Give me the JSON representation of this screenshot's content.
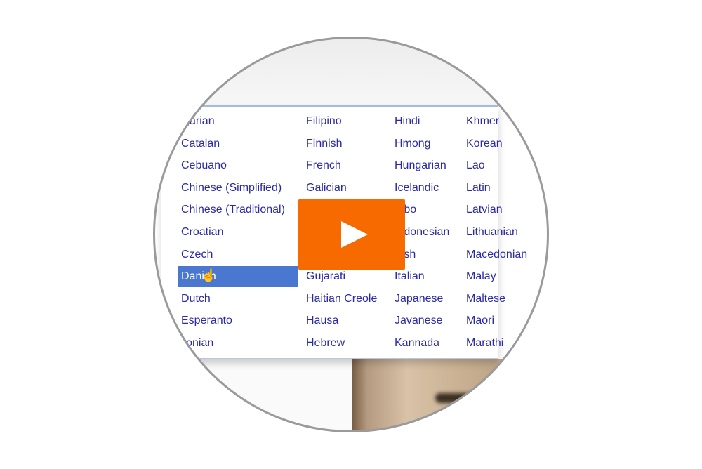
{
  "language_menu": {
    "columns": [
      [
        "Bulgarian",
        "Catalan",
        "Cebuano",
        "Chinese (Simplified)",
        "Chinese (Traditional)",
        "Croatian",
        "Czech",
        "Danish",
        "Dutch",
        "Esperanto",
        "Estonian"
      ],
      [
        "Filipino",
        "Finnish",
        "French",
        "Galician",
        "",
        "",
        "",
        "Gujarati",
        "Haitian Creole",
        "Hausa",
        "Hebrew"
      ],
      [
        "Hindi",
        "Hmong",
        "Hungarian",
        "Icelandic",
        "Igbo",
        "Indonesian",
        "Irish",
        "Italian",
        "Japanese",
        "Javanese",
        "Kannada"
      ],
      [
        "Khmer",
        "Korean",
        "Lao",
        "Latin",
        "Latvian",
        "Lithuanian",
        "Macedonian",
        "Malay",
        "Maltese",
        "Maori",
        "Marathi"
      ]
    ],
    "selected": "Danish"
  },
  "play_button": {
    "icon": "play-icon",
    "color": "#f66a00"
  },
  "colors": {
    "link": "#2a2aa8",
    "highlight": "#4a78d0"
  }
}
